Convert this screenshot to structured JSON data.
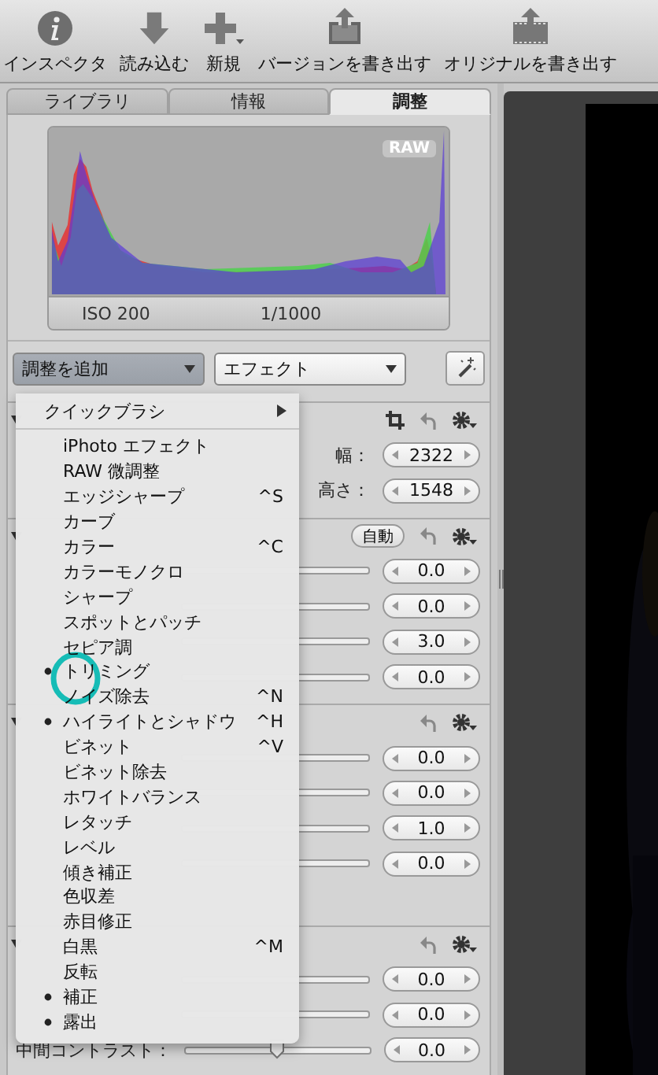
{
  "toolbar": [
    {
      "kind": "info",
      "label": "インスペクタ"
    },
    {
      "kind": "import",
      "label": "読み込む"
    },
    {
      "kind": "new",
      "label": "新規"
    },
    {
      "kind": "export",
      "label": "バージョンを書き出す"
    },
    {
      "kind": "export-film",
      "label": "オリジナルを書き出す"
    }
  ],
  "tabs": [
    {
      "label": "ライブラリ",
      "selected": false
    },
    {
      "label": "情報",
      "selected": false
    },
    {
      "label": "調整",
      "selected": true
    }
  ],
  "histogram": {
    "badge": "RAW",
    "iso": "ISO 200",
    "shutter": "1/1000"
  },
  "popups": [
    {
      "label": "調整を追加",
      "pressed": true
    },
    {
      "label": "エフェクト",
      "pressed": false
    }
  ],
  "sections": [
    {
      "crop_tool": true,
      "rows": [
        {
          "kind": "stepper",
          "label": "幅：",
          "value": "2322"
        },
        {
          "kind": "stepper",
          "label": "高さ：",
          "value": "1548"
        }
      ]
    },
    {
      "auto_button": "自動",
      "rows": [
        {
          "kind": "slider",
          "value": "0.0"
        },
        {
          "kind": "slider",
          "value": "0.0"
        },
        {
          "kind": "slider",
          "value": "3.0"
        },
        {
          "kind": "slider",
          "value": "0.0"
        }
      ]
    },
    {
      "rows": [
        {
          "kind": "slider",
          "value": "0.0"
        },
        {
          "kind": "slider",
          "value": "0.0"
        },
        {
          "kind": "slider",
          "value": "1.0"
        },
        {
          "kind": "slider",
          "value": "0.0"
        },
        {
          "kind": "blank"
        }
      ]
    },
    {
      "rows": [
        {
          "kind": "slider",
          "value": "0.0"
        },
        {
          "kind": "slider",
          "value": "0.0"
        },
        {
          "kind": "slider",
          "label": "中間コントラスト：",
          "value": "0.0",
          "level": 0.5
        }
      ]
    }
  ],
  "menu": {
    "title": "クイックブラシ",
    "items": [
      {
        "label": "iPhoto エフェクト",
        "bullet": false
      },
      {
        "label": "RAW 微調整",
        "bullet": false
      },
      {
        "label": "エッジシャープ",
        "bullet": false,
        "shortcut": "^S"
      },
      {
        "label": "カーブ",
        "bullet": false
      },
      {
        "label": "カラー",
        "bullet": false,
        "shortcut": "^C"
      },
      {
        "label": "カラーモノクロ",
        "bullet": false
      },
      {
        "label": "シャープ",
        "bullet": false
      },
      {
        "label": "スポットとパッチ",
        "bullet": false
      },
      {
        "label": "セピア調",
        "bullet": false
      },
      {
        "label": "トリミング",
        "bullet": true,
        "circled": true
      },
      {
        "label": "ノイズ除去",
        "bullet": false,
        "shortcut": "^N"
      },
      {
        "label": "ハイライトとシャドウ",
        "bullet": true,
        "shortcut": "^H"
      },
      {
        "label": "ビネット",
        "bullet": false,
        "shortcut": "^V"
      },
      {
        "label": "ビネット除去",
        "bullet": false
      },
      {
        "label": "ホワイトバランス",
        "bullet": false
      },
      {
        "label": "レタッチ",
        "bullet": false
      },
      {
        "label": "レベル",
        "bullet": false
      },
      {
        "label": "傾き補正",
        "bullet": false
      },
      {
        "label": "色収差",
        "bullet": false
      },
      {
        "label": "赤目修正",
        "bullet": false
      },
      {
        "label": "白黒",
        "bullet": false,
        "shortcut": "^M"
      },
      {
        "label": "反転",
        "bullet": false
      },
      {
        "label": "補正",
        "bullet": true
      },
      {
        "label": "露出",
        "bullet": true
      }
    ]
  }
}
